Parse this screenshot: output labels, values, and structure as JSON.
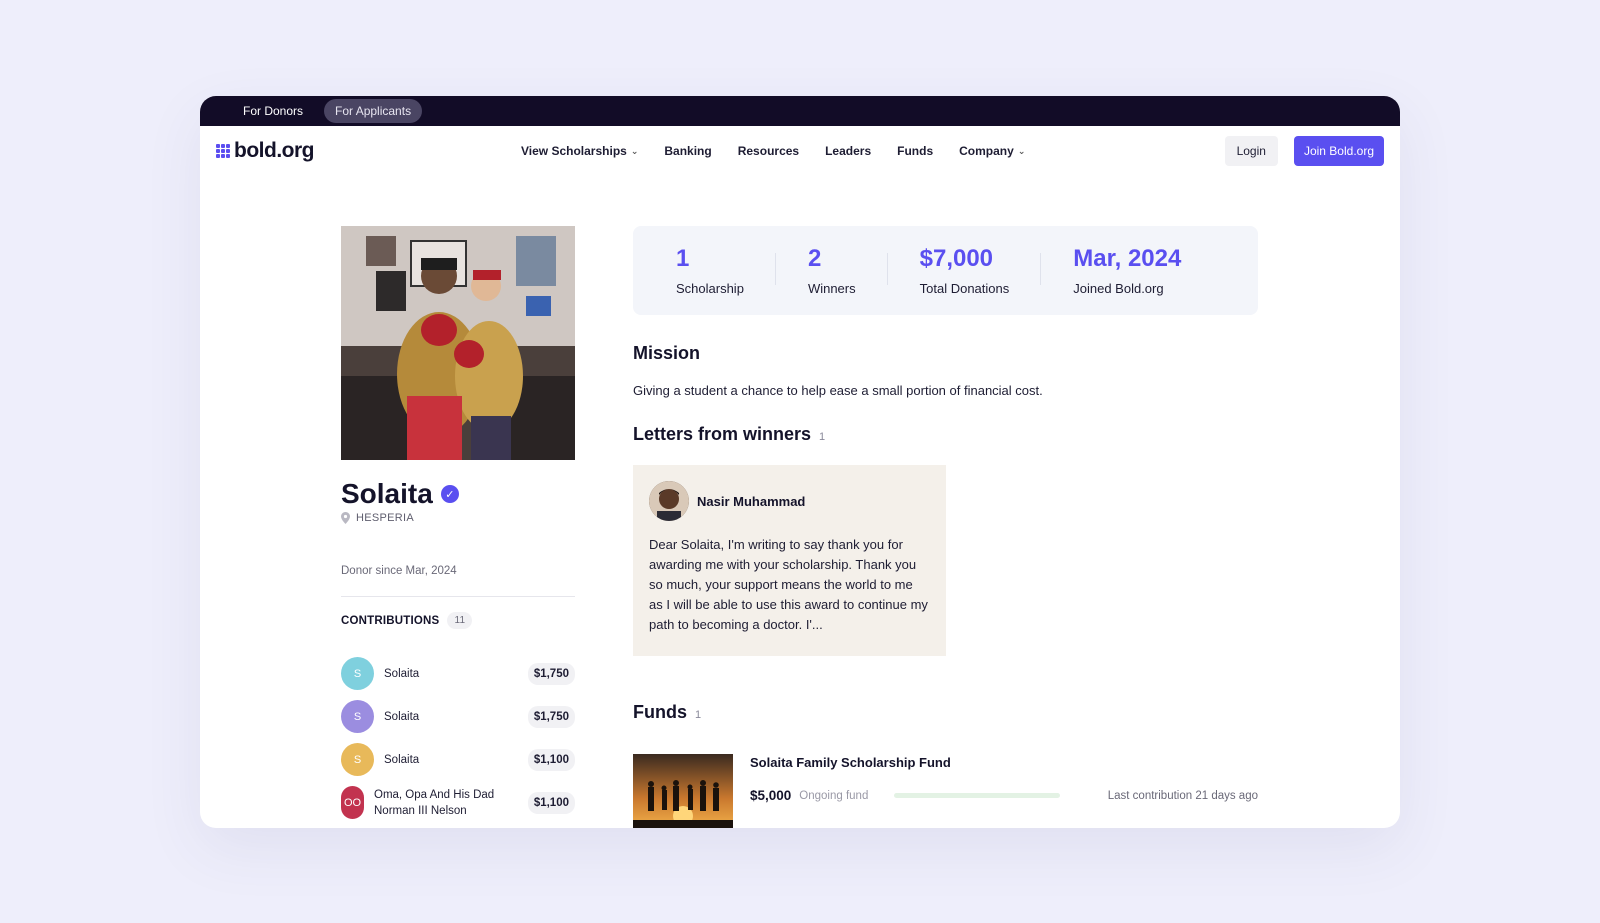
{
  "topbar": {
    "for_donors": "For Donors",
    "for_applicants": "For Applicants"
  },
  "nav": {
    "logo": "bold.org",
    "links": [
      {
        "label": "View Scholarships",
        "dropdown": true
      },
      {
        "label": "Banking"
      },
      {
        "label": "Resources"
      },
      {
        "label": "Leaders"
      },
      {
        "label": "Funds"
      },
      {
        "label": "Company",
        "dropdown": true
      }
    ],
    "login": "Login",
    "join": "Join Bold.org"
  },
  "profile": {
    "name": "Solaita",
    "location": "HESPERIA",
    "donor_since": "Donor since Mar, 2024",
    "verified_icon": "verified-check-icon"
  },
  "contributions": {
    "title": "CONTRIBUTIONS",
    "count": "11",
    "items": [
      {
        "initials": "S",
        "name": "Solaita",
        "amount": "$1,750",
        "color": "#7fd0de"
      },
      {
        "initials": "S",
        "name": "Solaita",
        "amount": "$1,750",
        "color": "#9b8de0"
      },
      {
        "initials": "S",
        "name": "Solaita",
        "amount": "$1,100",
        "color": "#e8b95a"
      },
      {
        "initials": "OO",
        "name": "Oma, Opa And His Dad Norman III Nelson",
        "amount": "$1,100",
        "color": "#c2334f"
      }
    ]
  },
  "stats": [
    {
      "value": "1",
      "label": "Scholarship"
    },
    {
      "value": "2",
      "label": "Winners"
    },
    {
      "value": "$7,000",
      "label": "Total Donations"
    },
    {
      "value": "Mar, 2024",
      "label": "Joined Bold.org"
    }
  ],
  "mission": {
    "title": "Mission",
    "text": "Giving a student a chance to help ease a small portion of financial cost."
  },
  "letters": {
    "title": "Letters from winners",
    "count": "1",
    "items": [
      {
        "name": "Nasir Muhammad",
        "text": "Dear Solaita, I'm writing to say thank you for awarding me with your scholarship. Thank you so much, your support means the world to me as I will be able to use this award to continue my path to becoming a doctor. I'..."
      }
    ]
  },
  "funds": {
    "title": "Funds",
    "count": "1",
    "items": [
      {
        "title": "Solaita Family Scholarship Fund",
        "amount": "$5,000",
        "status": "Ongoing fund",
        "progress": 0.0,
        "last_contribution": "Last contribution 21 days ago"
      }
    ]
  },
  "colors": {
    "accent": "#5a4ff0",
    "topbar": "#120c27",
    "background": "#eeeefb"
  }
}
